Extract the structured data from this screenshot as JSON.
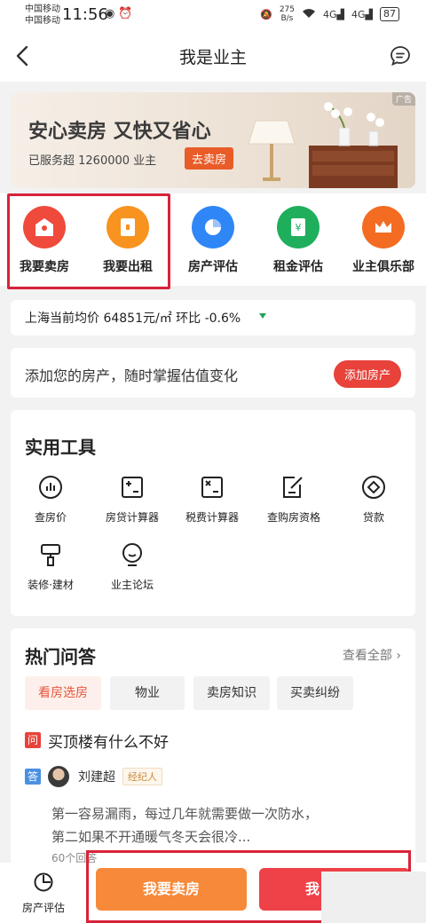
{
  "status": {
    "carrier1": "中国移动",
    "carrier2": "中国移动",
    "time": "11:56",
    "net_speed": "275",
    "net_unit": "B/s",
    "sig1": "4G",
    "sig2": "4G",
    "battery": "87"
  },
  "nav": {
    "title": "我是业主"
  },
  "banner": {
    "title": "安心卖房 又快又省心",
    "subtitle": "已服务超 1260000 业主",
    "button": "去卖房",
    "ad": "广告"
  },
  "entries": [
    {
      "label": "我要卖房",
      "color": "#ef4a3c"
    },
    {
      "label": "我要出租",
      "color": "#f7931e"
    },
    {
      "label": "房产评估",
      "color": "#2f86f6"
    },
    {
      "label": "租金评估",
      "color": "#1fae5c"
    },
    {
      "label": "业主俱乐部",
      "color": "#f36c22"
    }
  ],
  "price": {
    "text": "上海当前均价 64851元/㎡ 环比 -0.6%"
  },
  "add_house": {
    "text": "添加您的房产，随时掌握估值变化",
    "button": "添加房产"
  },
  "tools": {
    "title": "实用工具",
    "items": [
      "查房价",
      "房贷计算器",
      "税费计算器",
      "查购房资格",
      "贷款",
      "装修·建材",
      "业主论坛"
    ]
  },
  "qa": {
    "title": "热门问答",
    "view_all": "查看全部",
    "chips": [
      "看房选房",
      "物业",
      "卖房知识",
      "买卖纠纷"
    ],
    "question_badge": "问",
    "question": "买顶楼有什么不好",
    "answer_badge": "答",
    "answerer": "刘建超",
    "answerer_tag": "经纪人",
    "answer_line1": "第一容易漏雨，每过几年就需要做一次防水，",
    "answer_line2": "第二如果不开通暖气冬天会很冷...",
    "answer_count": "60个回答"
  },
  "bottom": {
    "eval_label": "房产评估",
    "sell_button": "我要卖房",
    "second_button": "我"
  }
}
